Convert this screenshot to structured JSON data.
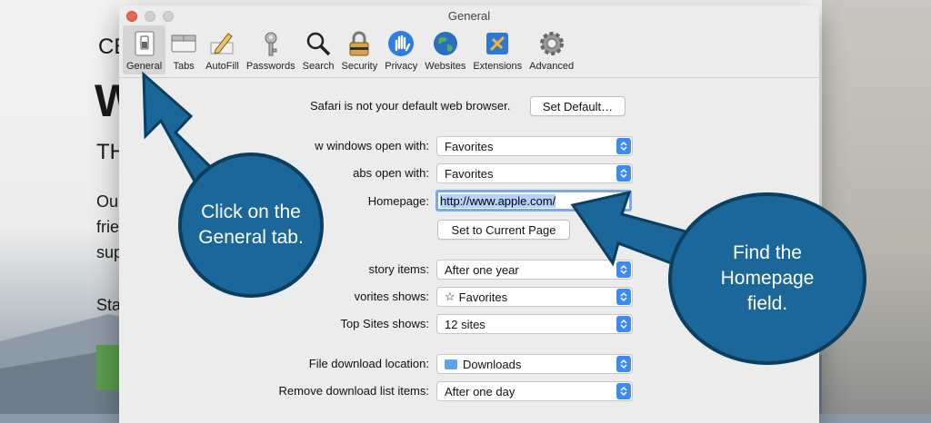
{
  "background_page": {
    "fragments": [
      "CE",
      "W",
      "TH",
      "Ou",
      "frie",
      "sup",
      "Sta"
    ]
  },
  "window": {
    "title": "General",
    "toolbar": [
      {
        "label": "General",
        "icon": "general-switch-icon",
        "selected": true
      },
      {
        "label": "Tabs",
        "icon": "tabs-icon"
      },
      {
        "label": "AutoFill",
        "icon": "autofill-pencil-icon"
      },
      {
        "label": "Passwords",
        "icon": "key-icon"
      },
      {
        "label": "Search",
        "icon": "magnifier-icon"
      },
      {
        "label": "Security",
        "icon": "lock-icon"
      },
      {
        "label": "Privacy",
        "icon": "hand-icon"
      },
      {
        "label": "Websites",
        "icon": "globe-icon"
      },
      {
        "label": "Extensions",
        "icon": "puzzle-icon"
      },
      {
        "label": "Advanced",
        "icon": "gear-icon"
      }
    ]
  },
  "general": {
    "default_browser_text": "Safari is not your default web browser.",
    "set_default_label": "Set Default…",
    "new_windows_label": "w windows open with:",
    "new_windows_value": "Favorites",
    "new_tabs_label": "abs open with:",
    "new_tabs_value": "Favorites",
    "homepage_label": "Homepage:",
    "homepage_value": "http://www.apple.com/",
    "set_current_label": "Set to Current Page",
    "history_label": "story items:",
    "history_value": "After one year",
    "favorites_label": "vorites shows:",
    "favorites_value": "Favorites",
    "topsites_label": "Top Sites shows:",
    "topsites_value": "12 sites",
    "download_location_label": "File download location:",
    "download_location_value": "Downloads",
    "remove_download_label": "Remove download list items:",
    "remove_download_value": "After one day"
  },
  "callouts": {
    "general_tab": "Click on the General tab.",
    "homepage": "Find the Homepage field."
  },
  "colors": {
    "callout_fill": "#1c6799",
    "callout_border": "#0b3e5f",
    "accent_blue": "#3d8bf0"
  }
}
